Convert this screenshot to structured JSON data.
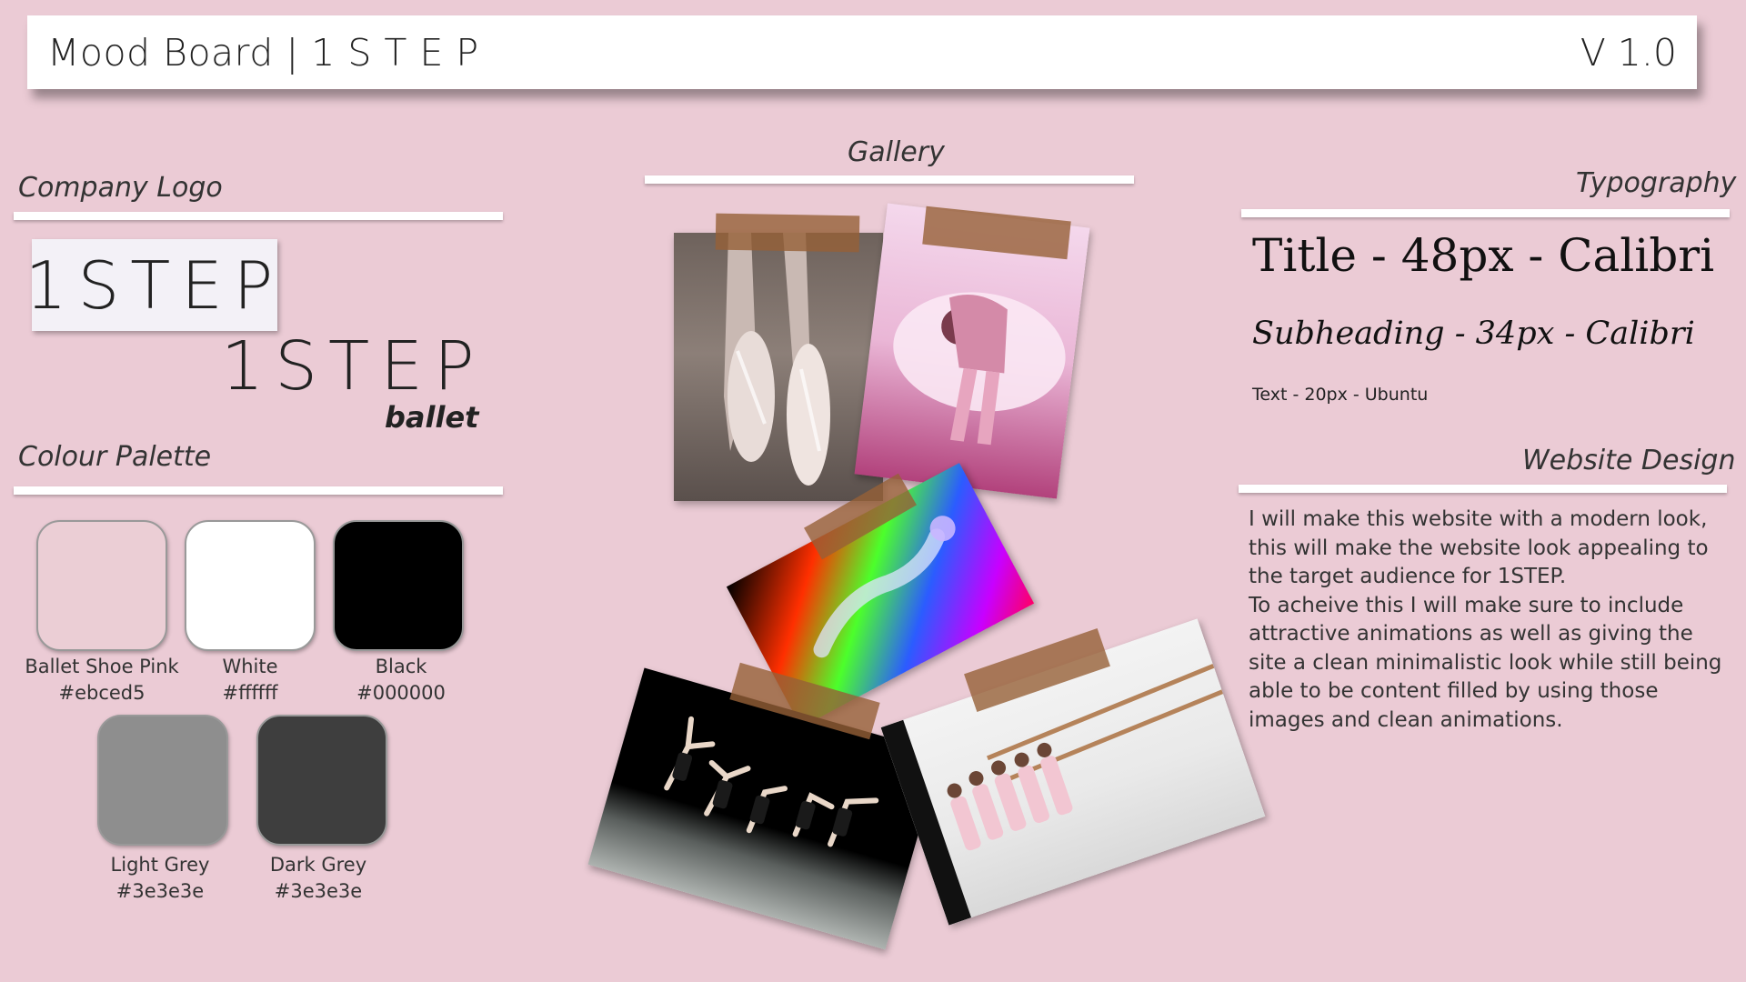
{
  "header": {
    "title": "Mood Board | 1 S T E P",
    "version": "V 1.0"
  },
  "sections": {
    "company_logo": "Company Logo",
    "colour_palette": "Colour Palette",
    "gallery": "Gallery",
    "typography": "Typography",
    "website_design": "Website Design"
  },
  "logo": {
    "primary": "1STEP",
    "secondary": "1STEP",
    "secondary_sub": "ballet"
  },
  "palette": [
    {
      "name": "Ballet Shoe Pink",
      "hex": "#ebced5",
      "color": "#ebced5"
    },
    {
      "name": "White",
      "hex": "#ffffff",
      "color": "#ffffff"
    },
    {
      "name": "Black",
      "hex": "#000000",
      "color": "#000000"
    },
    {
      "name": "Light Grey",
      "hex": "#3e3e3e",
      "color": "#8e8e8e"
    },
    {
      "name": "Dark Grey",
      "hex": "#3e3e3e",
      "color": "#3e3e3e"
    }
  ],
  "gallery": {
    "photos": [
      {
        "name": "pointe-shoes-photo"
      },
      {
        "name": "kneeling-ballerina-photo"
      },
      {
        "name": "rainbow-dancer-photo"
      },
      {
        "name": "stage-dancers-photo"
      },
      {
        "name": "ballet-studio-children-photo"
      }
    ]
  },
  "typography": {
    "title": "Title - 48px - Calibri",
    "subheading": "Subheading - 34px - Calibri",
    "text": "Text - 20px - Ubuntu"
  },
  "website_design": {
    "paragraph": "I will make this website with a modern look, this will make the website look appealing to the target audience for 1STEP.\nTo acheive this I will make sure to include attractive animations as well as giving the site a clean minimalistic look while still being able to be content filled by using those images and clean animations."
  }
}
